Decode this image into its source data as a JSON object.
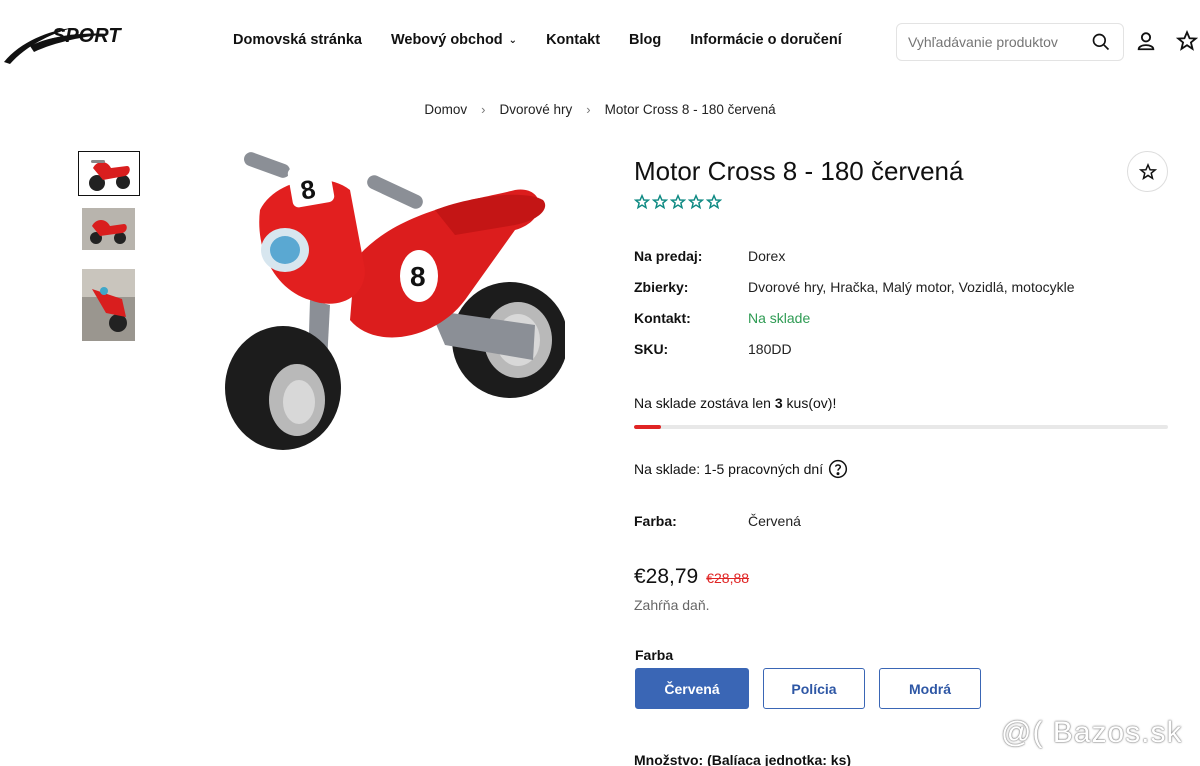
{
  "header": {
    "logo_text": "SPORT",
    "nav": [
      {
        "label": "Domovská stránka"
      },
      {
        "label": "Webový obchod",
        "has_dropdown": true
      },
      {
        "label": "Kontakt"
      },
      {
        "label": "Blog"
      },
      {
        "label": "Informácie o doručení"
      }
    ],
    "search_placeholder": "Vyhľadávanie produktov",
    "icons": [
      "search-icon",
      "user-icon",
      "star-icon"
    ]
  },
  "breadcrumb": [
    "Domov",
    "Dvorové hry",
    "Motor Cross 8 - 180 červená"
  ],
  "product": {
    "title": "Motor Cross 8 - 180 červená",
    "rating_stars": 5,
    "meta": [
      {
        "key": "Na predaj:",
        "value": "Dorex"
      },
      {
        "key": "Zbierky:",
        "value": "Dvorové hry, Hračka, Malý motor, Vozidlá, motocykle"
      },
      {
        "key": "Kontakt:",
        "value": "Na sklade",
        "highlight": true
      },
      {
        "key": "SKU:",
        "value": "180DD"
      }
    ],
    "stock": {
      "prefix": "Na sklade zostáva len",
      "count": "3",
      "suffix": "kus(ov)!",
      "level_fraction": 0.05
    },
    "delivery": "Na sklade: 1-5 pracovných dní",
    "color_key": "Farba:",
    "color_value": "Červená",
    "price_now": "€28,79",
    "price_old": "€28,88",
    "tax_note": "Zahŕňa daň.",
    "options_label": "Farba",
    "options": [
      "Červená",
      "Polícia",
      "Modrá"
    ],
    "selected_option": "Červená",
    "quantity_label": "Množstvo: (Balíaca jednotka: ks)"
  },
  "watermark": "@( Bazos.sk",
  "colors": {
    "accent": "#3a66b5",
    "green": "#2e9b53",
    "red": "#e02424",
    "stars": "#0f8a83"
  }
}
